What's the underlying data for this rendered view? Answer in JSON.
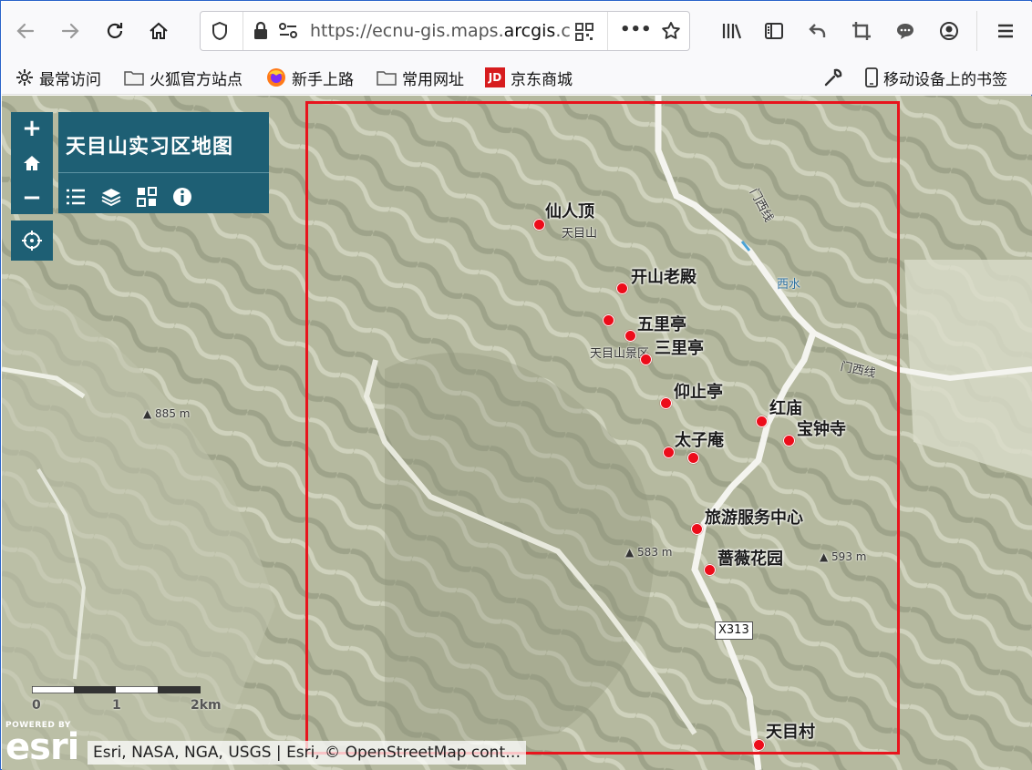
{
  "browser": {
    "url_prefix": "https://ecnu-gis.maps.",
    "url_domain": "arcgis",
    "url_suffix": ".c",
    "overflow_label": "•••"
  },
  "bookmarks": [
    {
      "label": "最常访问",
      "icon": "gear-icon"
    },
    {
      "label": "火狐官方站点",
      "icon": "folder-icon"
    },
    {
      "label": "新手上路",
      "icon": "firefox-icon"
    },
    {
      "label": "常用网址",
      "icon": "folder-icon"
    },
    {
      "label": "京东商城",
      "icon": "jd-icon",
      "icon_text": "JD"
    },
    {
      "label": "移动设备上的书签",
      "icon": "mobile-icon"
    }
  ],
  "map_app": {
    "title": "天目山实习区地图",
    "zoom_in": "+",
    "zoom_out": "−"
  },
  "pois": [
    {
      "name": "仙人顶"
    },
    {
      "name": "开山老殿"
    },
    {
      "name": "五里亭"
    },
    {
      "name": "三里亭"
    },
    {
      "name": "仰止亭"
    },
    {
      "name": "红庙"
    },
    {
      "name": "宝钟寺"
    },
    {
      "name": "太子庵"
    },
    {
      "name": "旅游服务中心"
    },
    {
      "name": "蔷薇花园"
    },
    {
      "name": "天目村"
    }
  ],
  "basemap_labels": {
    "tianmushan": "天目山",
    "scenic_area": "天目山景区",
    "xishui": "西水",
    "road_1": "门西线",
    "road_2": "门西线",
    "road_shield": "X313"
  },
  "elevations": [
    "885 m",
    "583 m",
    "593 m"
  ],
  "scale": {
    "labels": [
      "0",
      "1",
      "2km"
    ]
  },
  "attribution": {
    "powered_by": "POWERED BY",
    "logo": "esri",
    "text": "Esri, NASA, NGA, USGS | Esri, © OpenStreetMap cont…"
  },
  "colors": {
    "widget_bg": "#1e5f74",
    "poi": "#ed0c1a",
    "extent_box": "#e8141d"
  }
}
